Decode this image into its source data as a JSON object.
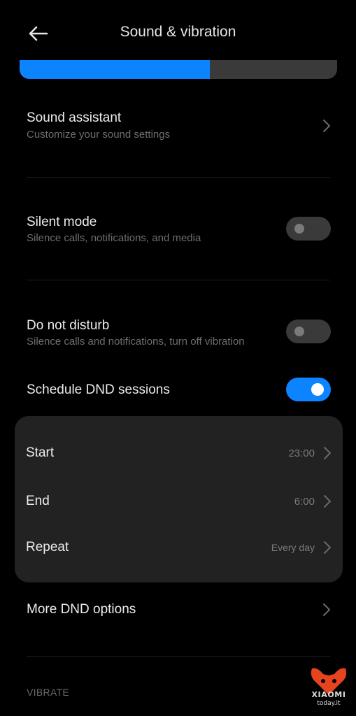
{
  "header": {
    "title": "Sound & vibration",
    "back_icon": "arrow-left-icon"
  },
  "volume": {
    "level_fraction": 0.6,
    "fill_color": "#0d84ff",
    "track_color": "#3a3a3a"
  },
  "sound_assistant": {
    "title": "Sound assistant",
    "subtitle": "Customize your sound settings"
  },
  "silent_mode": {
    "title": "Silent mode",
    "subtitle": "Silence calls, notifications, and media",
    "enabled": false
  },
  "do_not_disturb": {
    "title": "Do not disturb",
    "subtitle": "Silence calls and notifications, turn off vibration",
    "enabled": false
  },
  "schedule_dnd": {
    "title": "Schedule DND sessions",
    "enabled": true
  },
  "schedule": {
    "start": {
      "label": "Start",
      "value": "23:00"
    },
    "end": {
      "label": "End",
      "value": "6:00"
    },
    "repeat": {
      "label": "Repeat",
      "value": "Every day"
    }
  },
  "more_dnd": {
    "title": "More DND options"
  },
  "sections": {
    "vibrate_label": "VIBRATE"
  },
  "watermark": {
    "brand": "XIAOMI",
    "site": "today.it",
    "color": "#e8431f"
  },
  "colors": {
    "accent": "#0d84ff",
    "background": "#000000",
    "card": "#222222"
  }
}
